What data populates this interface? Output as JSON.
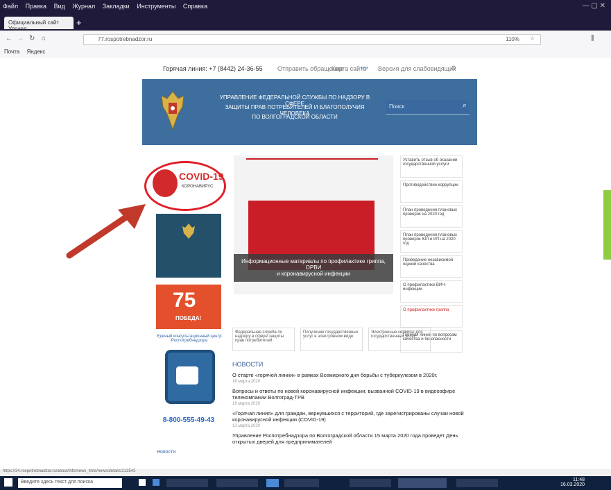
{
  "browser": {
    "menu": [
      "Файл",
      "Правка",
      "Вид",
      "Журнал",
      "Закладки",
      "Инструменты",
      "Справка"
    ],
    "tab_title": "Официальный сайт Управл...",
    "url": "77.rospotrebnadzor.ru",
    "bookmarks": [
      "Почта",
      "Яндекс"
    ],
    "zoom": "110%"
  },
  "topline": {
    "hotline": "Горячая линия: +7 (8442) 24-36-55",
    "appeal": "Отправить обращение",
    "map": "Карта сайта",
    "vision": "Версия для слабовидящих"
  },
  "header": {
    "line1": "УПРАВЛЕНИЕ ФЕДЕРАЛЬНОЙ СЛУЖБЫ ПО НАДЗОРУ В СФЕРЕ",
    "line2": "ЗАЩИТЫ ПРАВ ПОТРЕБИТЕЛЕЙ И БЛАГОПОЛУЧИЯ ЧЕЛОВЕКА",
    "line3": "ПО ВОЛГОГРАДСКОЙ ОБЛАСТИ",
    "search_placeholder": "Поиск"
  },
  "covid": {
    "title": "COVID-19",
    "subtitle": "КОРОНАВИРУС"
  },
  "pobeda": {
    "number": "75",
    "label": "ПОБЕДА!"
  },
  "left": {
    "hotline_caption": "Единый консультационный центр Роспотребнадзора",
    "phone_number": "8-800-555-49-43",
    "news_link": "Новости"
  },
  "slider": {
    "caption_line1": "Информационные материалы по профилактике гриппа, ОРВИ",
    "caption_line2": "и коронавирусной инфекции"
  },
  "sidebar": [
    {
      "label": "Уставить отзыв об оказании государственной услуги",
      "red": false
    },
    {
      "label": "Противодействие коррупции",
      "red": false
    },
    {
      "label": "План проведения плановых проверок на 2020 год",
      "red": false
    },
    {
      "label": "План проведения плановых проверок ЮЛ и ИП на 2020 год",
      "red": false
    },
    {
      "label": "Проведение независимой оценки качества",
      "red": false
    },
    {
      "label": "О профилактике ВИЧ-инфекции",
      "red": false
    },
    {
      "label": "О профилактике гриппа",
      "red": true
    },
    {
      "label": "Горячая линия по вопросам качества и безопасности",
      "red": false
    }
  ],
  "links_row": [
    "Федеральная служба по надзору в сфере защиты прав потребителей",
    "Получение государственных услуг в электронном виде",
    "Электронные сервисы для государственных услуг"
  ],
  "news": {
    "title": "НОВОСТИ",
    "items": [
      {
        "text": "О старте «горячей линии» в рамках Всемирного дня борьбы с туберкулезом в 2020г.",
        "date": "16 марта 2020"
      },
      {
        "text": "Вопросы и ответы по новой коронавирусной инфекции, вызванной COVID-19 в видеоэфире телекомпании Волгоград-ТРВ",
        "date": "16 марта 2020"
      },
      {
        "text": "«Горячая линия» для граждан, вернувшихся с территорий, где зарегистрированы случаи новой коронавирусной инфекции (COVID-19)",
        "date": "13 марта 2020"
      },
      {
        "text": "Управление Роспотребнадзора по Волгоградской области 15 марта 2020 года проведет День открытых дверей для предпринимателей",
        "date": "13 марта 2020"
      }
    ]
  },
  "statusbar": "https://34.rospotrebnadzor.ru/about/info/news_time/news/details/213543",
  "taskbar": {
    "search_placeholder": "Введите здесь текст для поиска",
    "time": "11:48",
    "date": "16.03.2020"
  },
  "colors": {
    "header_blue": "#3d6e9e",
    "covid_circle": "#e0202a",
    "arrow": "#c0392b"
  }
}
